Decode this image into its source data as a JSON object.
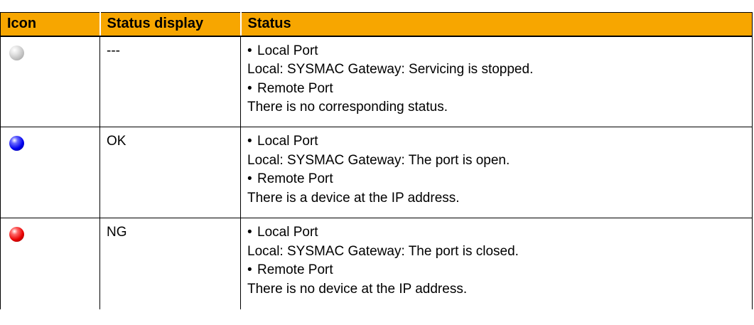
{
  "table": {
    "headers": [
      "Icon",
      "Status display",
      "Status"
    ],
    "rows": [
      {
        "icon": "gray-ball-icon",
        "display": "---",
        "lines": [
          {
            "bullet": "•",
            "text": "Local Port"
          },
          {
            "text": "Local: SYSMAC Gateway: Servicing is stopped."
          },
          {
            "bullet": "•",
            "text": "Remote Port"
          },
          {
            "text": "There is no corresponding status."
          }
        ]
      },
      {
        "icon": "blue-ball-icon",
        "display": "OK",
        "lines": [
          {
            "bullet": "•",
            "text": "Local Port"
          },
          {
            "text": "Local: SYSMAC Gateway: The port is open."
          },
          {
            "bullet": "•",
            "text": "Remote Port"
          },
          {
            "text": "There is a device at the IP address."
          }
        ]
      },
      {
        "icon": "red-ball-icon",
        "display": "NG",
        "lines": [
          {
            "bullet": "•",
            "text": "Local Port"
          },
          {
            "text": "Local: SYSMAC Gateway: The port is closed."
          },
          {
            "bullet": "•",
            "text": "Remote Port"
          },
          {
            "text": "There is no device at the IP address."
          }
        ]
      }
    ]
  },
  "colors": {
    "header_background": "#f7a600",
    "gray_icon": "#b9b9b9",
    "blue_icon": "#0000ee",
    "red_icon": "#e80000"
  }
}
